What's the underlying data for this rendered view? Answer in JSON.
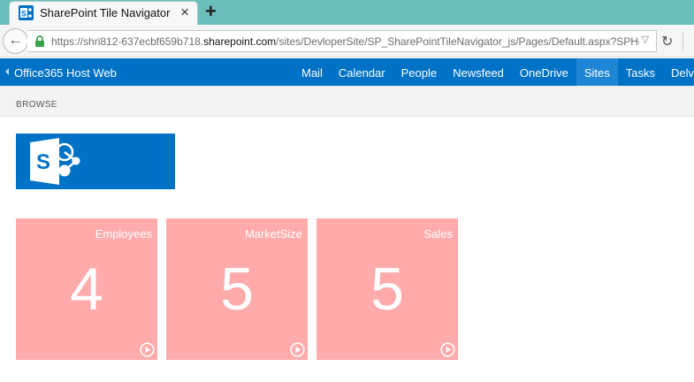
{
  "browser": {
    "tab_title": "SharePoint Tile Navigator",
    "tab_close": "×",
    "new_tab": "+",
    "url_prefix": "https://shri812-637ecbf659b718.",
    "url_host": "sharepoint.com",
    "url_path": "/sites/DevloperSite/SP_SharePointTileNavigator_js/Pages/Default.aspx?SPHo",
    "url_dropdown": "▽",
    "reload": "↻",
    "back": "←"
  },
  "suitebar": {
    "title": "Office365 Host Web",
    "links": [
      "Mail",
      "Calendar",
      "People",
      "Newsfeed",
      "OneDrive",
      "Sites",
      "Tasks",
      "Delve"
    ],
    "active_link": "Sites"
  },
  "ribbon": {
    "browse_label": "BROWSE"
  },
  "tiles": [
    {
      "title": "Employees",
      "count": "4"
    },
    {
      "title": "MarketSize",
      "count": "5"
    },
    {
      "title": "Sales",
      "count": "5"
    }
  ],
  "colors": {
    "suitebar": "#0072c6",
    "tile": "#ffaaab",
    "tabbar": "#6cc0bc"
  },
  "icons": {
    "favicon": "sharepoint-icon",
    "lock": "lock-icon",
    "tile_arrow": "play-circle-icon",
    "logo": "sharepoint-logo"
  }
}
